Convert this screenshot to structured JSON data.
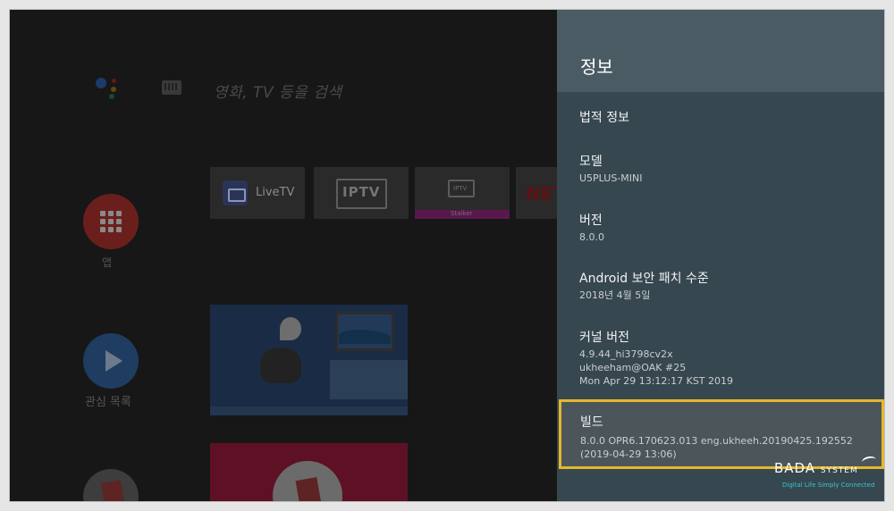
{
  "search": {
    "hint": "영화, TV 등을 검색"
  },
  "side_nav": [
    {
      "label": "앱"
    },
    {
      "label": "관심 목록"
    }
  ],
  "channels": {
    "livetv": "LiveTV",
    "iptv": "IPTV",
    "stalker_icon": "IPTV",
    "stalker": "Stalker",
    "netflix": "NET"
  },
  "panel": {
    "title": "정보",
    "items": [
      {
        "title": "법적 정보"
      },
      {
        "title": "모델",
        "value": "U5PLUS-MINI"
      },
      {
        "title": "버전",
        "value": "8.0.0"
      },
      {
        "title": "Android 보안 패치 수준",
        "value": "2018년 4월 5일"
      },
      {
        "title": "커널 버전",
        "lines": [
          "4.9.44_hi3798cv2x",
          "ukheeham@OAK #25",
          "Mon Apr 29 13:12:17 KST 2019"
        ]
      },
      {
        "title": "빌드",
        "lines": [
          "8.0.0 OPR6.170623.013 eng.ukheeh.20190425.192552",
          "(2019-04-29 13:06)"
        ],
        "selected": true
      }
    ]
  },
  "watermark": {
    "brand": "BADA",
    "brand_suffix": "SYSTEM",
    "tagline": "Digital Life Simply Connected"
  },
  "colors": {
    "panel_bg": "#37474f",
    "panel_header": "#4a5b63",
    "highlight_border": "#e5b82a",
    "watermark_tagline": "#35c7cf"
  }
}
